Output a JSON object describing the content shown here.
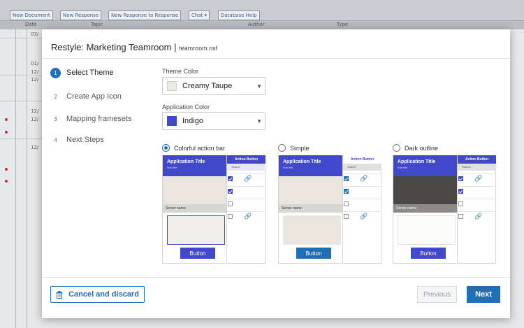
{
  "toolbar": {
    "buttons": [
      "New Document",
      "New Response",
      "New Response to Response",
      "Chat",
      "Database Help"
    ]
  },
  "view_header": {
    "date": "Date",
    "topic": "Topic",
    "author": "Author",
    "type": "Type"
  },
  "view_dates": [
    "03/",
    "01/",
    "12/",
    "12/",
    "12/",
    "12/",
    "12/"
  ],
  "dialog": {
    "title": "Restyle: Marketing Teamroom",
    "separator": "|",
    "filename": "teamroom.nsf",
    "steps": [
      {
        "num": "1",
        "label": "Select Theme",
        "active": true
      },
      {
        "num": "2",
        "label": "Create App Icon",
        "active": false
      },
      {
        "num": "3",
        "label": "Mapping framesets",
        "active": false
      },
      {
        "num": "4",
        "label": "Next Steps",
        "active": false
      }
    ],
    "theme_color": {
      "label": "Theme Color",
      "value": "Creamy Taupe",
      "swatch": "#ece9e2"
    },
    "application_color": {
      "label": "Application Color",
      "value": "Indigo",
      "swatch": "#4148c9"
    },
    "styles": [
      {
        "label": "Colorful action bar",
        "selected": true
      },
      {
        "label": "Simple",
        "selected": false
      },
      {
        "label": "Dark outline",
        "selected": false
      }
    ],
    "preview": {
      "app_title": "Application Title",
      "subtitle": "Sub title",
      "action_button": "Action Button",
      "search": "Search",
      "server_name": "Server name:",
      "button": "Button"
    },
    "cancel_label": "Cancel and discard",
    "previous_label": "Previous",
    "next_label": "Next"
  },
  "colors": {
    "accent": "#1f6fb8",
    "indigo": "#4148c9",
    "taupe": "#ece9e2"
  }
}
